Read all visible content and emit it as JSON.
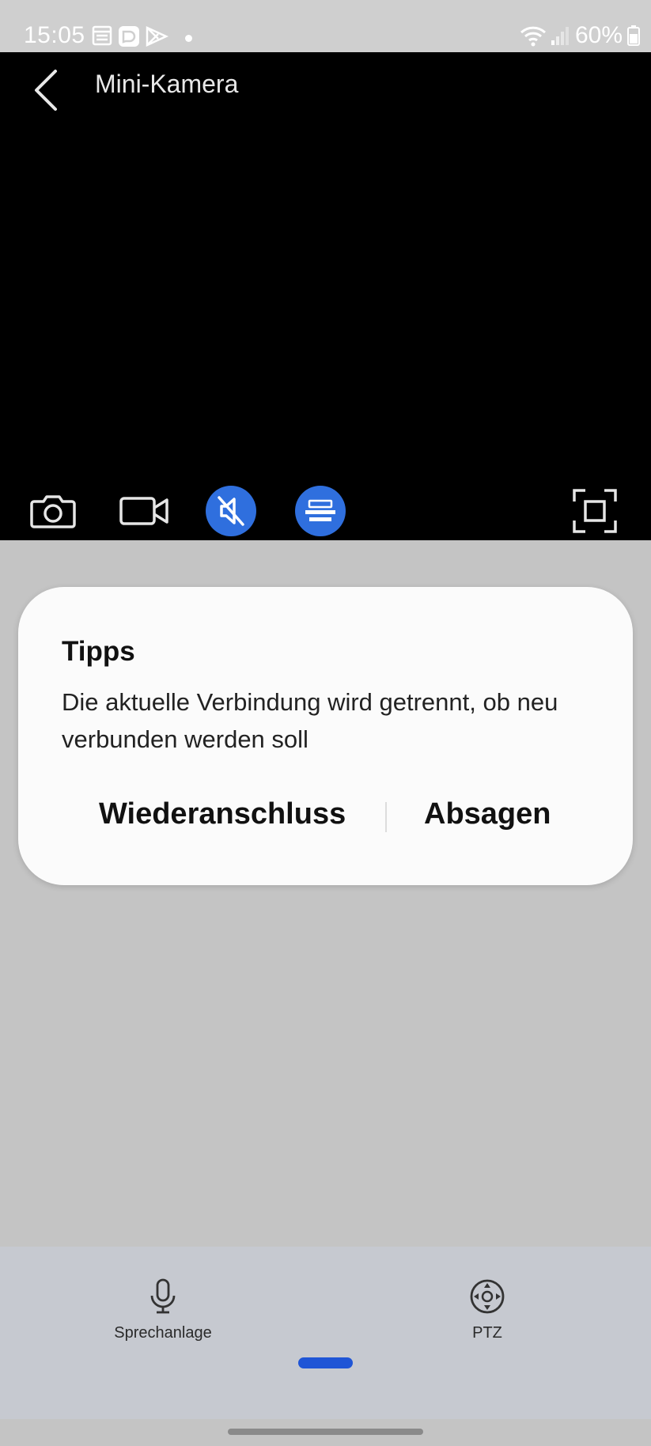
{
  "status_bar": {
    "time": "15:05",
    "battery": "60%",
    "icons": [
      "calendar-icon",
      "messenger-icon",
      "play-store-icon",
      "dot-icon",
      "wifi-icon",
      "signal-icon",
      "battery-icon"
    ]
  },
  "header": {
    "title": "Mini-Kamera",
    "back_icon": "back-arrow-icon"
  },
  "video_controls": [
    {
      "name": "snapshot",
      "icon": "camera-icon"
    },
    {
      "name": "record",
      "icon": "video-camera-icon"
    },
    {
      "name": "mute",
      "icon": "speaker-muted-icon",
      "active": true
    },
    {
      "name": "quality",
      "icon": "quality-icon",
      "active": true
    },
    {
      "name": "fullscreen",
      "icon": "fullscreen-icon"
    }
  ],
  "dialog": {
    "title": "Tipps",
    "message": "Die aktuelle Verbindung wird getrennt, ob neu verbunden werden soll",
    "confirm_label": "Wiederanschluss",
    "cancel_label": "Absagen"
  },
  "bottom_nav": {
    "items": [
      {
        "label": "Sprechanlage",
        "icon": "microphone-icon"
      },
      {
        "label": "PTZ",
        "icon": "ptz-joystick-icon"
      }
    ]
  },
  "colors": {
    "accent": "#2f6fde",
    "indicator": "#1f55d6",
    "page_background": "#c4c4c4",
    "video_background": "#000000"
  }
}
